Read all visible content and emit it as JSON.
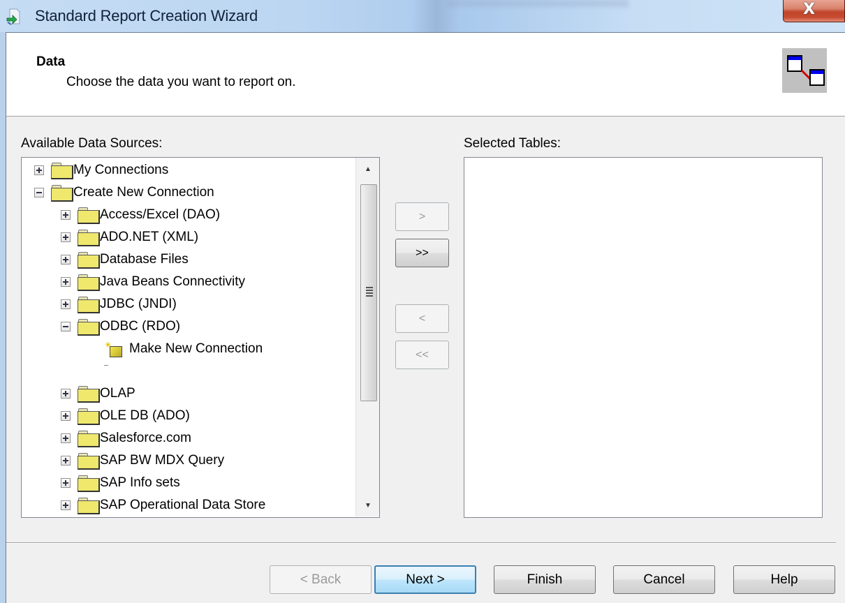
{
  "window": {
    "title": "Standard Report Creation Wizard",
    "close_label": "X"
  },
  "header": {
    "title": "Data",
    "subtitle": "Choose the data you want to report on."
  },
  "available": {
    "label": "Available Data Sources:",
    "items": [
      {
        "label": "My Connections",
        "level": 0,
        "state": "collapsed",
        "icon": "folder-icon"
      },
      {
        "label": "Create New Connection",
        "level": 0,
        "state": "expanded",
        "icon": "folder-icon"
      },
      {
        "label": "Access/Excel (DAO)",
        "level": 1,
        "state": "collapsed",
        "icon": "folder-icon"
      },
      {
        "label": "ADO.NET (XML)",
        "level": 1,
        "state": "collapsed",
        "icon": "folder-icon"
      },
      {
        "label": "Database Files",
        "level": 1,
        "state": "collapsed",
        "icon": "folder-icon"
      },
      {
        "label": "Java Beans Connectivity",
        "level": 1,
        "state": "collapsed",
        "icon": "folder-icon"
      },
      {
        "label": "JDBC (JNDI)",
        "level": 1,
        "state": "collapsed",
        "icon": "folder-icon"
      },
      {
        "label": "ODBC (RDO)",
        "level": 1,
        "state": "expanded",
        "icon": "folder-icon"
      },
      {
        "label": "Make New Connection",
        "level": 2,
        "state": "leaf",
        "icon": "new-connection-icon"
      },
      {
        "label": "",
        "level": 2,
        "state": "blank",
        "icon": ""
      },
      {
        "label": "OLAP",
        "level": 1,
        "state": "collapsed",
        "icon": "folder-icon"
      },
      {
        "label": "OLE DB (ADO)",
        "level": 1,
        "state": "collapsed",
        "icon": "folder-icon"
      },
      {
        "label": "Salesforce.com",
        "level": 1,
        "state": "collapsed",
        "icon": "folder-icon"
      },
      {
        "label": "SAP BW MDX Query",
        "level": 1,
        "state": "collapsed",
        "icon": "folder-icon"
      },
      {
        "label": "SAP Info sets",
        "level": 1,
        "state": "collapsed",
        "icon": "folder-icon"
      },
      {
        "label": "SAP Operational Data Store",
        "level": 1,
        "state": "collapsed",
        "icon": "folder-icon"
      }
    ]
  },
  "selected": {
    "label": "Selected Tables:",
    "items": []
  },
  "transfer": {
    "add_one": ">",
    "add_all": ">>",
    "remove_one": "<",
    "remove_all": "<<"
  },
  "footer": {
    "back": "< Back",
    "next": "Next >",
    "finish": "Finish",
    "cancel": "Cancel",
    "help": "Help"
  }
}
